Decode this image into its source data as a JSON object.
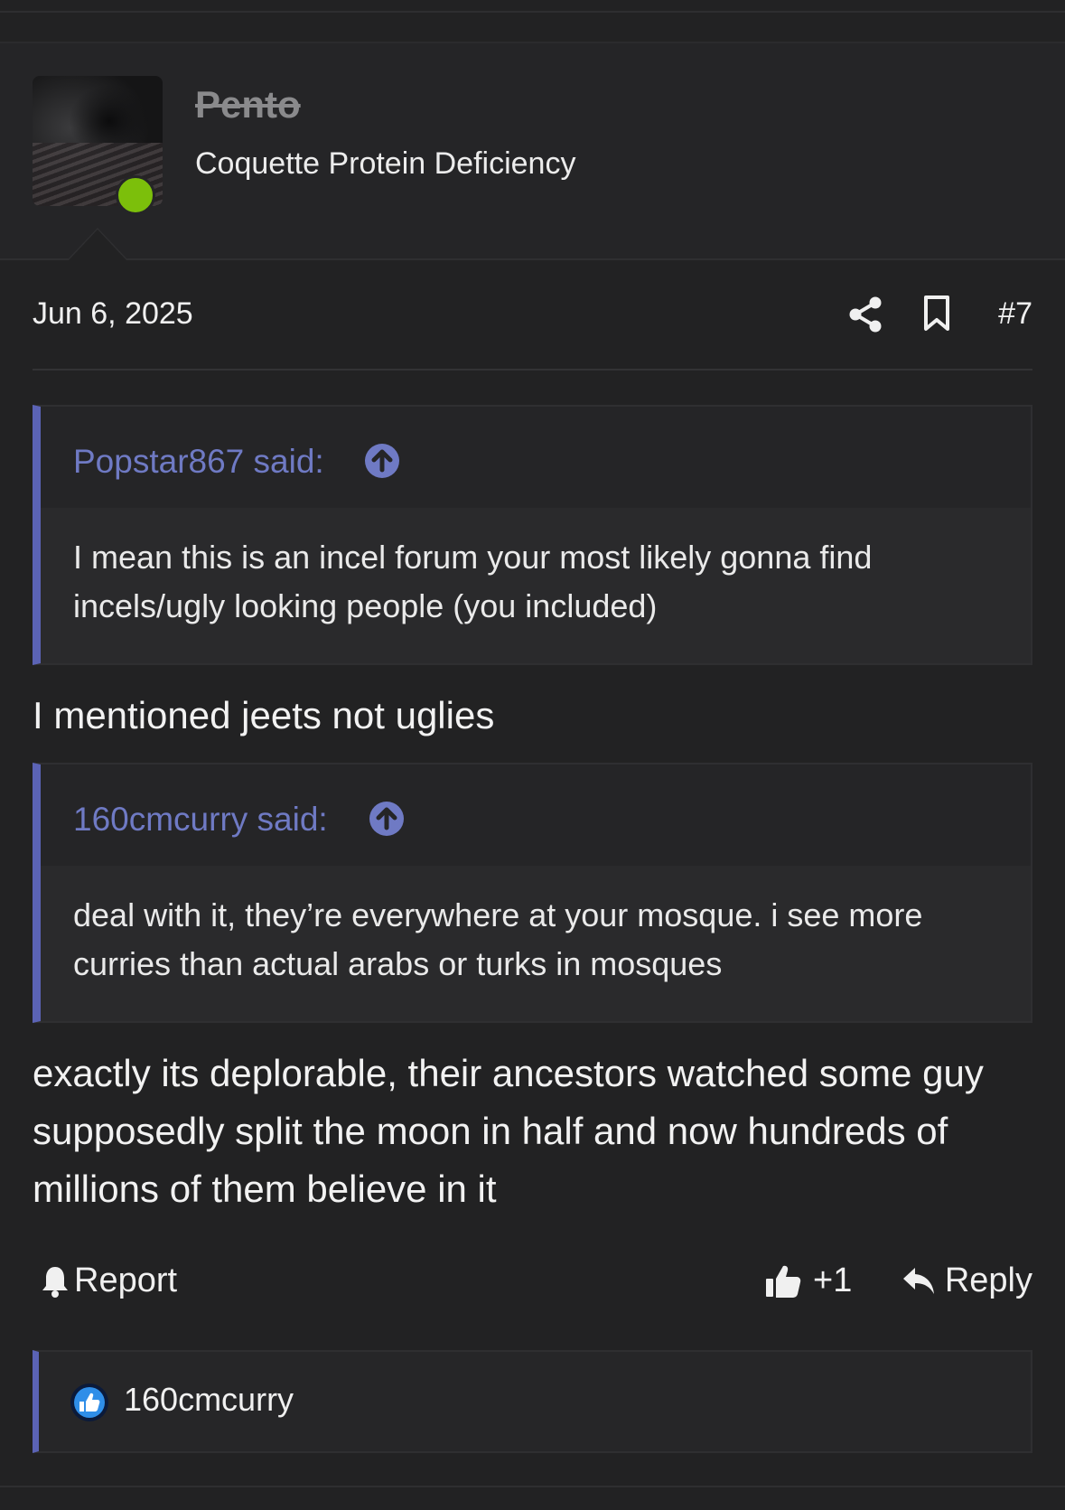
{
  "user": {
    "name": "Pento",
    "title": "Coquette Protein Deficiency",
    "online": true,
    "online_color": "#7cbf0b"
  },
  "post": {
    "date": "Jun 6, 2025",
    "number": "#7",
    "share_icon": "share-icon",
    "bookmark_icon": "bookmark-icon"
  },
  "quotes": [
    {
      "author": "Popstar867 said:",
      "text": "I mean this is an incel forum your most likely gonna find incels/ugly looking people (you included)"
    },
    {
      "author": "160cmcurry said:",
      "text": "deal with it, they’re everywhere at your mosque. i see more curries than actual arabs or turks in mosques"
    }
  ],
  "replies": [
    "I mentioned jeets not uglies",
    "exactly its deplorable, their ancestors watched some guy supposedly split the moon in half and now hundreds of millions of them believe in it"
  ],
  "actions": {
    "report": "Report",
    "like_count": "+1",
    "reply": "Reply"
  },
  "reactions": {
    "users": "160cmcurry",
    "icon": "like-reaction-icon"
  },
  "colors": {
    "accent": "#5b63b5",
    "link": "#6f7ac4",
    "background": "#222223"
  }
}
